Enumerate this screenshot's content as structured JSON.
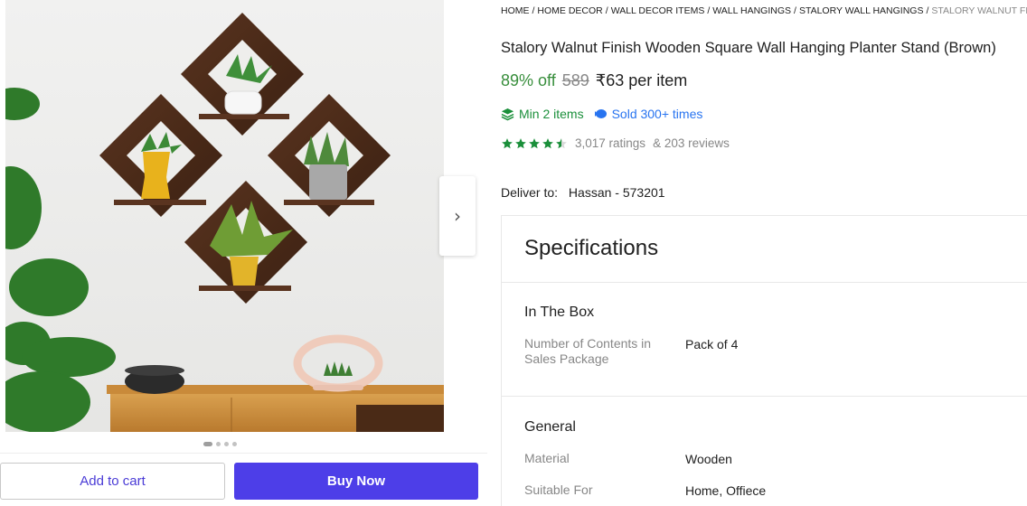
{
  "breadcrumb": [
    {
      "label": "HOME"
    },
    {
      "label": "HOME DECOR"
    },
    {
      "label": "WALL DECOR ITEMS"
    },
    {
      "label": "WALL HANGINGS"
    },
    {
      "label": "STALORY WALL HANGINGS"
    },
    {
      "label": "STALORY WALNUT FINISH"
    }
  ],
  "product": {
    "title": "Stalory Walnut Finish Wooden Square Wall Hanging Planter Stand (Brown)",
    "discount": "89% off",
    "mrp": "589",
    "price": "₹63 per item",
    "min_items": "Min 2 items",
    "sold": "Sold 300+ times",
    "rating_value": 4.5,
    "ratings_text": "3,017 ratings",
    "reviews_text": "& 203 reviews",
    "star_color": "#1a8f3a"
  },
  "delivery": {
    "label": "Deliver to:",
    "location": "Hassan - 573201"
  },
  "gallery": {
    "image_count": 4,
    "active_index": 0,
    "next_icon": "chevron-right-icon"
  },
  "actions": {
    "add_to_cart": "Add to cart",
    "buy_now": "Buy Now",
    "buy_color": "#4d3ee8"
  },
  "specifications": {
    "title": "Specifications",
    "groups": [
      {
        "title": "In The Box",
        "rows": [
          {
            "key": "Number of Contents in Sales Package",
            "value": "Pack of 4"
          }
        ]
      },
      {
        "title": "General",
        "rows": [
          {
            "key": "Material",
            "value": "Wooden"
          },
          {
            "key": "Suitable For",
            "value": "Home, Offiece"
          }
        ]
      }
    ]
  }
}
